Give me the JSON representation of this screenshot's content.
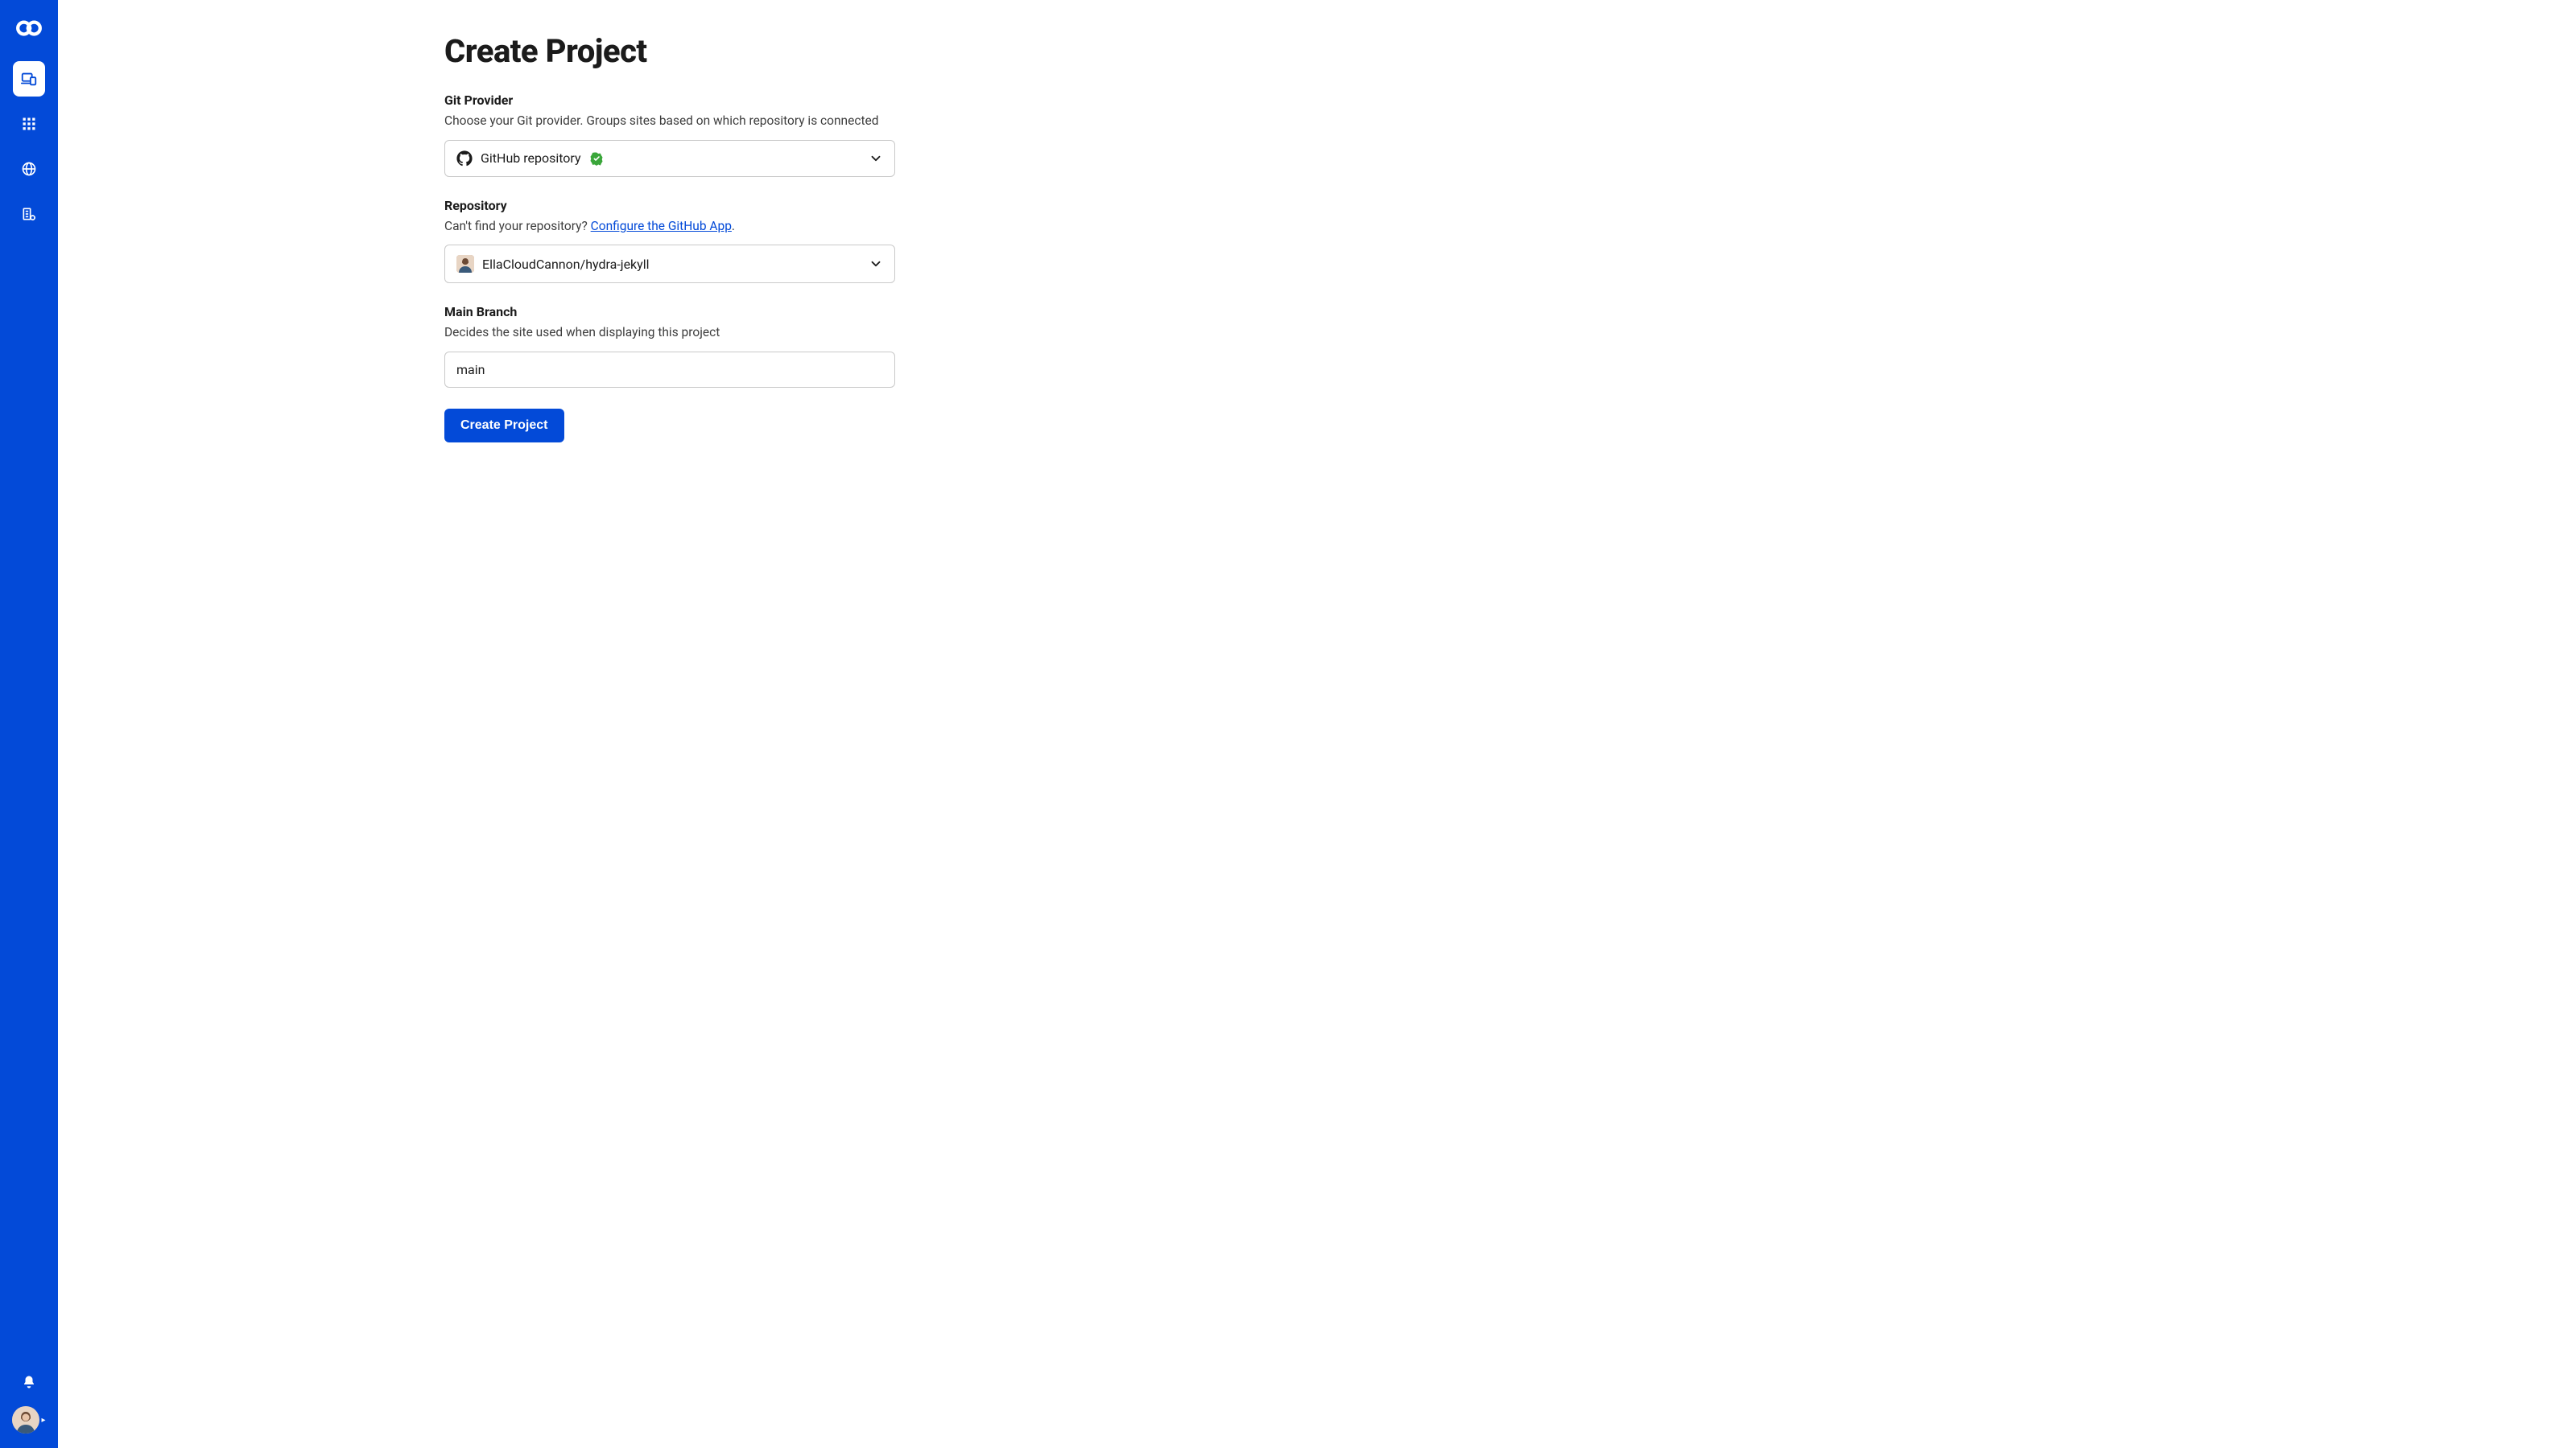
{
  "page": {
    "title": "Create Project"
  },
  "fields": {
    "gitProvider": {
      "label": "Git Provider",
      "help": "Choose your Git provider. Groups sites based on which repository is connected",
      "value": "GitHub repository"
    },
    "repository": {
      "label": "Repository",
      "helpPrefix": "Can't find your repository? ",
      "helpLink": "Configure the GitHub App",
      "helpSuffix": ".",
      "value": "EllaCloudCannon/hydra-jekyll"
    },
    "mainBranch": {
      "label": "Main Branch",
      "help": "Decides the site used when displaying this project",
      "value": "main"
    }
  },
  "actions": {
    "submit": "Create Project"
  }
}
